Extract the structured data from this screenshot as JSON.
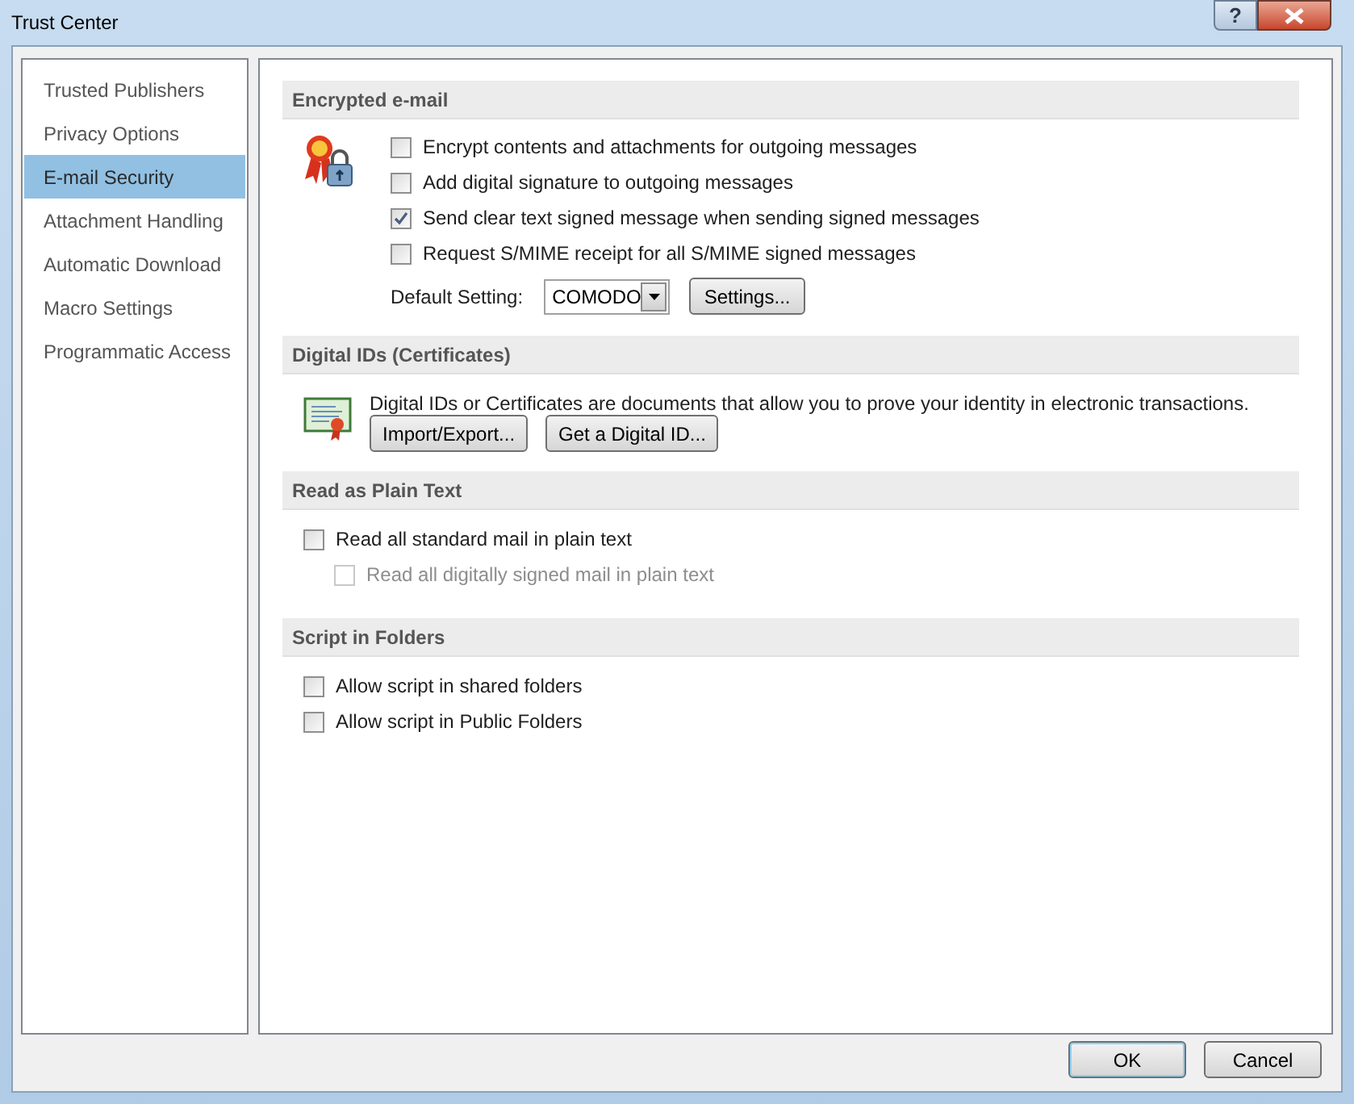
{
  "window": {
    "title": "Trust Center",
    "help": "?"
  },
  "sidebar": {
    "items": [
      {
        "label": "Trusted Publishers",
        "selected": false
      },
      {
        "label": "Privacy Options",
        "selected": false
      },
      {
        "label": "E-mail Security",
        "selected": true
      },
      {
        "label": "Attachment Handling",
        "selected": false
      },
      {
        "label": "Automatic Download",
        "selected": false
      },
      {
        "label": "Macro Settings",
        "selected": false
      },
      {
        "label": "Programmatic Access",
        "selected": false
      }
    ]
  },
  "encrypted_email": {
    "title": "Encrypted e-mail",
    "options": [
      {
        "label": "Encrypt contents and attachments for outgoing messages",
        "checked": false
      },
      {
        "label": "Add digital signature to outgoing messages",
        "checked": false
      },
      {
        "label": "Send clear text signed message when sending signed messages",
        "checked": true
      },
      {
        "label": "Request S/MIME receipt for all S/MIME signed messages",
        "checked": false
      }
    ],
    "default_setting": {
      "label": "Default Setting:",
      "value": "COMODO"
    },
    "settings_button": "Settings..."
  },
  "digital_ids": {
    "title": "Digital IDs (Certificates)",
    "description": "Digital IDs or Certificates are documents that allow you to prove your identity in electronic transactions.",
    "buttons": [
      "Import/Export...",
      "Get a Digital ID..."
    ]
  },
  "read_as_plain_text": {
    "title": "Read as Plain Text",
    "options": [
      {
        "label": "Read all standard mail in plain text",
        "checked": false,
        "disabled": false,
        "children": [
          {
            "label": "Read all digitally signed mail in plain text",
            "checked": false,
            "disabled": true
          }
        ]
      }
    ]
  },
  "script_in_folders": {
    "title": "Script in Folders",
    "options": [
      {
        "label": "Allow script in shared folders",
        "checked": false,
        "disabled": false
      },
      {
        "label": "Allow script in Public Folders",
        "checked": false,
        "disabled": false
      }
    ]
  },
  "buttons": [
    {
      "label": "OK",
      "default": true
    },
    {
      "label": "Cancel",
      "default": false
    }
  ]
}
